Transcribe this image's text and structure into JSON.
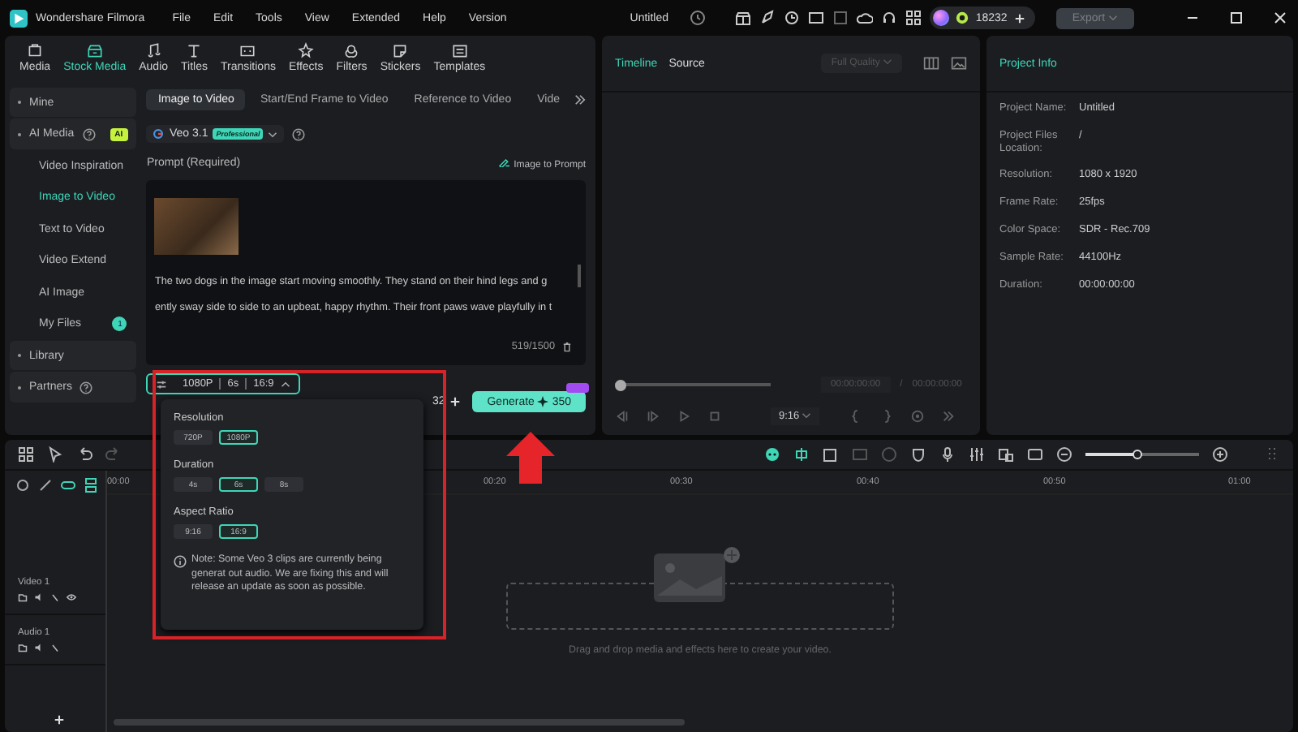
{
  "app": {
    "name": "Wondershare Filmora"
  },
  "menu": [
    "File",
    "Edit",
    "Tools",
    "View",
    "Extended",
    "Help",
    "Version"
  ],
  "document_title": "Untitled",
  "credits": "18232",
  "export_button": {
    "label": "Export",
    "disabled": true
  },
  "media_tabs": [
    {
      "label": "Media",
      "selected": false,
      "kind": "media"
    },
    {
      "label": "Stock Media",
      "selected": true,
      "kind": "stock"
    },
    {
      "label": "Audio",
      "selected": false,
      "kind": "audio"
    },
    {
      "label": "Titles",
      "selected": false,
      "kind": "titles"
    },
    {
      "label": "Transitions",
      "selected": false,
      "kind": "transitions"
    },
    {
      "label": "Effects",
      "selected": false,
      "kind": "effects"
    },
    {
      "label": "Filters",
      "selected": false,
      "kind": "filters"
    },
    {
      "label": "Stickers",
      "selected": false,
      "kind": "stickers"
    },
    {
      "label": "Templates",
      "selected": false,
      "kind": "templates"
    }
  ],
  "sidebar": {
    "items": [
      {
        "label": "Mine",
        "kind": "section",
        "selected": false,
        "help": false
      },
      {
        "label": "AI Media",
        "kind": "section",
        "selected": false,
        "help": true,
        "badge": "AI"
      },
      {
        "label": "Video Inspiration",
        "kind": "item",
        "selected": false,
        "help": false
      },
      {
        "label": "Image to Video",
        "kind": "item",
        "selected": true,
        "help": false
      },
      {
        "label": "Text to Video",
        "kind": "item",
        "selected": false,
        "help": false
      },
      {
        "label": "Video Extend",
        "kind": "item",
        "selected": false,
        "help": false
      },
      {
        "label": "AI Image",
        "kind": "item",
        "selected": false,
        "help": false
      },
      {
        "label": "My Files",
        "kind": "item",
        "selected": false,
        "help": false,
        "count": "1"
      },
      {
        "label": "Library",
        "kind": "section",
        "selected": false,
        "help": false
      },
      {
        "label": "Partners",
        "kind": "section",
        "selected": false,
        "help": true
      }
    ]
  },
  "generator_tabs": [
    {
      "label": "Image to Video",
      "selected": true
    },
    {
      "label": "Start/End Frame to Video",
      "selected": false
    },
    {
      "label": "Reference to Video",
      "selected": false
    },
    {
      "label": "Vide",
      "selected": false
    }
  ],
  "model": {
    "name": "Veo 3.1",
    "badge": "Professional"
  },
  "prompt": {
    "label": "Prompt (Required)",
    "image_to_prompt": "Image to Prompt",
    "lines": [
      "The two dogs in the image start moving smoothly. They stand on their hind legs and g",
      "ently sway side to side to an upbeat, happy rhythm. Their front paws wave playfully in t"
    ],
    "counter": "519/1500"
  },
  "settings_summary": [
    "1080P",
    "6s",
    "16:9"
  ],
  "credits_partial": "32",
  "generate": {
    "label": "Generate",
    "cost": "350"
  },
  "popup": {
    "sections": [
      {
        "title": "Resolution",
        "options": [
          {
            "label": "720P",
            "selected": false
          },
          {
            "label": "1080P",
            "selected": true
          }
        ]
      },
      {
        "title": "Duration",
        "options": [
          {
            "label": "4s",
            "selected": false
          },
          {
            "label": "6s",
            "selected": true
          },
          {
            "label": "8s",
            "selected": false
          }
        ]
      },
      {
        "title": "Aspect Ratio",
        "options": [
          {
            "label": "9:16",
            "selected": false
          },
          {
            "label": "16:9",
            "selected": true
          }
        ]
      }
    ],
    "note": "Note: Some Veo 3 clips are currently being generat out audio. We are fixing this and will release an update as soon as possible."
  },
  "preview": {
    "tabs": [
      {
        "label": "Timeline",
        "selected": true
      },
      {
        "label": "Source",
        "selected": false
      }
    ],
    "quality": "Full Quality",
    "current_time": "00:00:00:00",
    "separator": "/",
    "total_time": "00:00:00:00",
    "level": 0,
    "ratio": "9:16"
  },
  "project_info": {
    "title": "Project Info",
    "rows": [
      {
        "label": "Project Name:",
        "value": "Untitled"
      },
      {
        "label": "Project Files Location:",
        "value": "/"
      },
      {
        "label": "Resolution:",
        "value": "1080 x 1920"
      },
      {
        "label": "Frame Rate:",
        "value": "25fps"
      },
      {
        "label": "Color Space:",
        "value": "SDR - Rec.709"
      },
      {
        "label": "Sample Rate:",
        "value": "44100Hz"
      },
      {
        "label": "Duration:",
        "value": "00:00:00:00"
      }
    ]
  },
  "timeline": {
    "zoom": {
      "level": 0.45
    },
    "ruler": [
      "00:00",
      "00:20",
      "00:30",
      "00:40",
      "00:50",
      "01:00"
    ],
    "tracks": [
      {
        "name": "Video 1",
        "kind": "video"
      },
      {
        "name": "Audio 1",
        "kind": "audio"
      }
    ],
    "drop_hint": "Drag and drop media and effects here to create your video."
  }
}
